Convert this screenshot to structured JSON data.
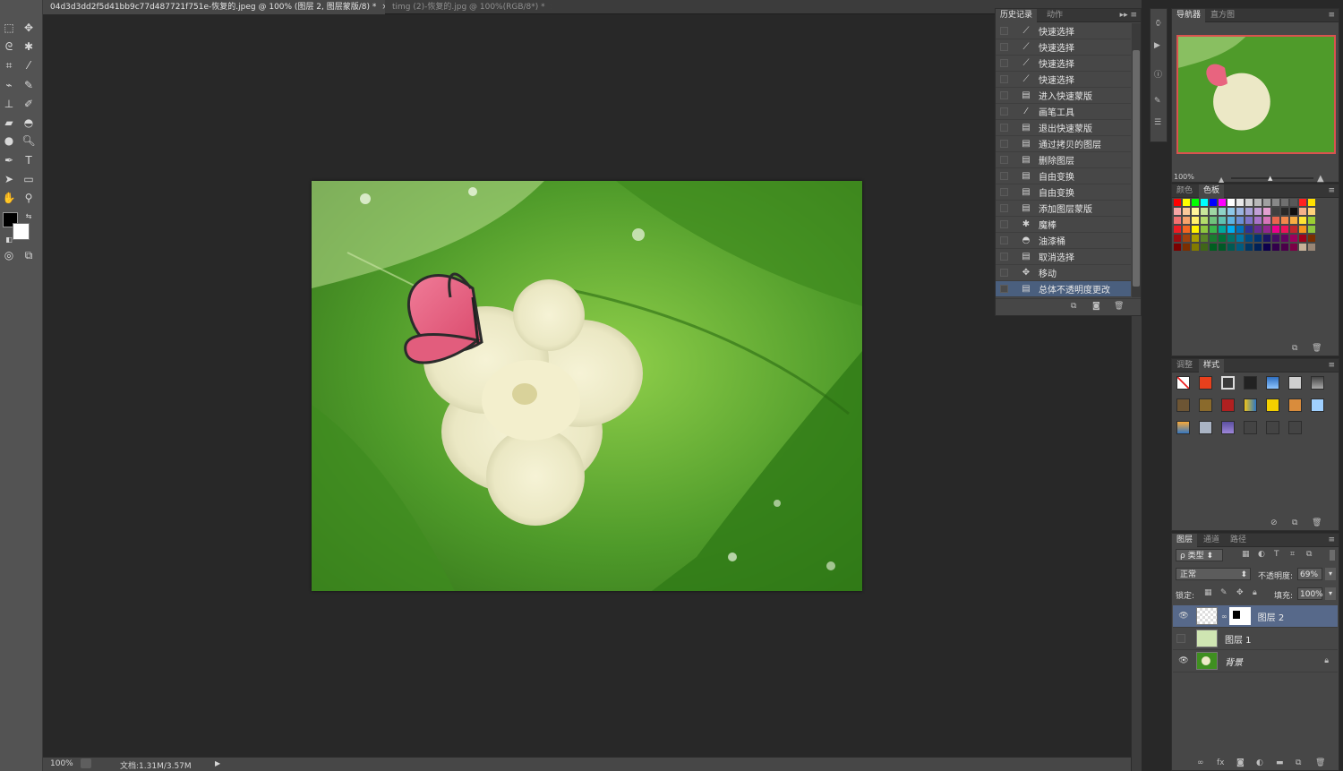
{
  "tabs": [
    {
      "label": "04d3d3dd2f5d41bb9c77d487721f751e-恢复的.jpeg @ 100% (图层 2, 图层蒙版/8) *",
      "close": "×"
    },
    {
      "label": "timg (2)-恢复的.jpg @ 100%(RGB/8*) *",
      "close": "×"
    }
  ],
  "status": {
    "zoom": "100%",
    "doc": "文档:1.31M/3.57M",
    "arrow": "▶"
  },
  "history_panel": {
    "tabs": [
      "历史记录",
      "动作"
    ],
    "items": [
      {
        "label": "快速选择",
        "icon": "quick-select-icon",
        "glyph": "⟋"
      },
      {
        "label": "快速选择",
        "icon": "quick-select-icon",
        "glyph": "⟋"
      },
      {
        "label": "快速选择",
        "icon": "quick-select-icon",
        "glyph": "⟋"
      },
      {
        "label": "快速选择",
        "icon": "quick-select-icon",
        "glyph": "⟋"
      },
      {
        "label": "进入快速蒙版",
        "icon": "document-icon",
        "glyph": "▤"
      },
      {
        "label": "画笔工具",
        "icon": "brush-icon",
        "glyph": "⁄"
      },
      {
        "label": "退出快速蒙版",
        "icon": "document-icon",
        "glyph": "▤"
      },
      {
        "label": "通过拷贝的图层",
        "icon": "document-icon",
        "glyph": "▤"
      },
      {
        "label": "删除图层",
        "icon": "document-icon",
        "glyph": "▤"
      },
      {
        "label": "自由变换",
        "icon": "document-icon",
        "glyph": "▤"
      },
      {
        "label": "自由变换",
        "icon": "document-icon",
        "glyph": "▤"
      },
      {
        "label": "添加图层蒙版",
        "icon": "document-icon",
        "glyph": "▤"
      },
      {
        "label": "魔棒",
        "icon": "magic-wand-icon",
        "glyph": "✱"
      },
      {
        "label": "油漆桶",
        "icon": "paint-bucket-icon",
        "glyph": "◓"
      },
      {
        "label": "取消选择",
        "icon": "document-icon",
        "glyph": "▤"
      },
      {
        "label": "移动",
        "icon": "move-icon",
        "glyph": "✥"
      },
      {
        "label": "总体不透明度更改",
        "icon": "document-icon",
        "glyph": "▤"
      }
    ],
    "selected_index": 16
  },
  "navigator_panel": {
    "tabs": [
      "导航器",
      "直方图"
    ],
    "zoom": "100%"
  },
  "swatches_panel": {
    "tabs": [
      "颜色",
      "色板"
    ]
  },
  "styles_panel": {
    "tabs": [
      "调整",
      "样式"
    ]
  },
  "layers_panel": {
    "tabs": [
      "图层",
      "通道",
      "路径"
    ],
    "filter_label": "ρ 类型",
    "blend_mode": "正常",
    "opacity_label": "不透明度:",
    "opacity_value": "69%",
    "lock_label": "锁定:",
    "fill_label": "填充:",
    "fill_value": "100%",
    "layers": [
      {
        "name": "图层 2",
        "visible": true,
        "selected": true,
        "has_mask": true
      },
      {
        "name": "图层 1",
        "visible": false,
        "selected": false,
        "has_mask": false
      },
      {
        "name": "背景",
        "visible": true,
        "selected": false,
        "has_mask": false,
        "locked": true
      }
    ]
  },
  "colors": {
    "selection": "#4a5f7e",
    "panel_bg": "#474747",
    "foreground": "#000000",
    "background": "#ffffff"
  }
}
